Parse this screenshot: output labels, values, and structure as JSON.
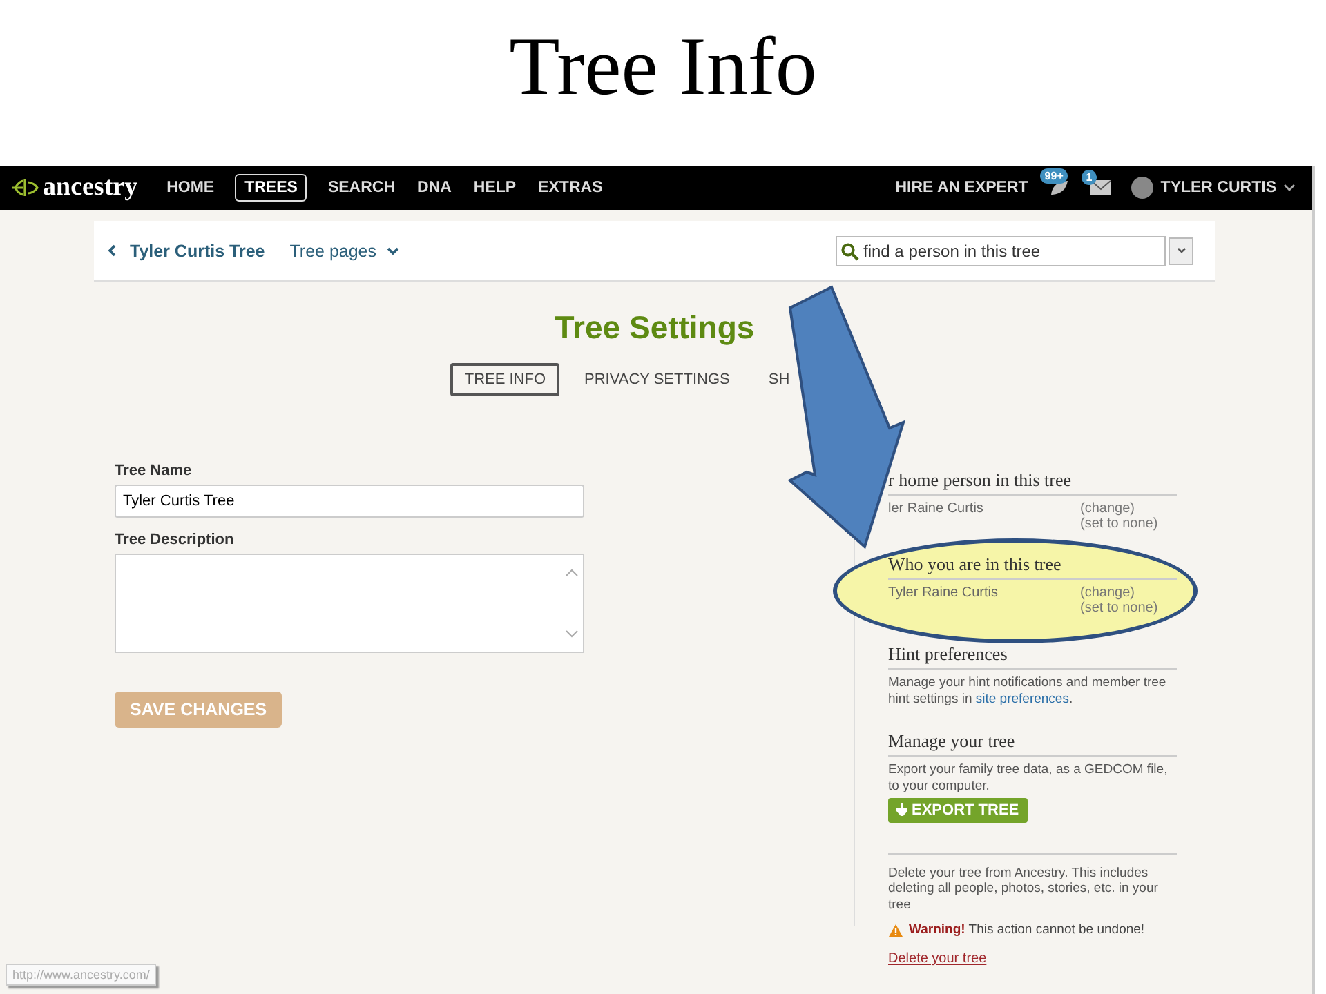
{
  "slide_title": "Tree Info",
  "nav": {
    "logo": "ancestry",
    "items": [
      {
        "label": "HOME",
        "selected": false
      },
      {
        "label": "TREES",
        "selected": true
      },
      {
        "label": "SEARCH",
        "selected": false
      },
      {
        "label": "DNA",
        "selected": false
      },
      {
        "label": "HELP",
        "selected": false
      },
      {
        "label": "EXTRAS",
        "selected": false
      }
    ],
    "hire": "HIRE AN EXPERT",
    "hints_badge": "99+",
    "messages_badge": "1",
    "user": "TYLER CURTIS"
  },
  "breadcrumb": {
    "back": "Tyler Curtis Tree",
    "pages": "Tree pages"
  },
  "search": {
    "placeholder": "find a person in this tree"
  },
  "page_title": "Tree Settings",
  "tabs": [
    {
      "label": "TREE INFO",
      "selected": true
    },
    {
      "label": "PRIVACY SETTINGS",
      "selected": false
    },
    {
      "label": "SH",
      "selected": false
    }
  ],
  "form": {
    "name_label": "Tree Name",
    "name_value": "Tyler Curtis Tree",
    "description_label": "Tree Description",
    "save": "SAVE CHANGES"
  },
  "sidebar": [
    {
      "kind": "person",
      "heading": "r home person in this tree",
      "person": "ler Raine Curtis",
      "change": "(change)",
      "set_none": "(set to none)",
      "highlighted": false
    },
    {
      "kind": "person",
      "heading": "Who you are in this tree",
      "person": "Tyler Raine Curtis",
      "change": "(change)",
      "set_none": "(set to none)",
      "highlighted": true
    },
    {
      "kind": "text",
      "heading": "Hint preferences",
      "text": "Manage your hint notifications and member tree hint settings in ",
      "link": "site preferences",
      "text_after": "."
    },
    {
      "kind": "export",
      "heading": "Manage your tree",
      "text": "Export your family tree data, as a GEDCOM file, to your computer.",
      "button": "EXPORT TREE"
    },
    {
      "kind": "delete",
      "text": "Delete your tree from Ancestry. This includes deleting all people, photos, stories, etc. in your tree",
      "warning": "**Warning!** This action cannot be undone!",
      "link": "Delete your tree"
    }
  ],
  "status_url": "http://www.ancestry.com/"
}
